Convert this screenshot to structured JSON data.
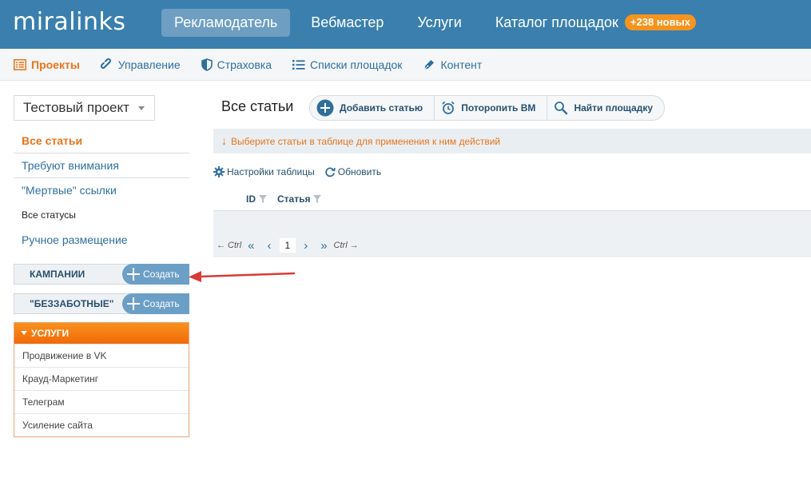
{
  "logo": "miralinks",
  "top_nav": {
    "items": [
      {
        "label": "Рекламодатель",
        "active": true
      },
      {
        "label": "Вебмастер",
        "active": false
      },
      {
        "label": "Услуги",
        "active": false
      },
      {
        "label": "Каталог площадок",
        "active": false
      }
    ],
    "catalog_badge": "+238 новых"
  },
  "sub_nav": {
    "items": [
      {
        "label": "Проекты",
        "icon": "list-icon",
        "active": true
      },
      {
        "label": "Управление",
        "icon": "link-icon",
        "active": false
      },
      {
        "label": "Страховка",
        "icon": "shield-icon",
        "active": false
      },
      {
        "label": "Списки площадок",
        "icon": "bullet-list-icon",
        "active": false
      },
      {
        "label": "Контент",
        "icon": "pen-icon",
        "active": false
      }
    ]
  },
  "sidebar": {
    "project": "Тестовый проект",
    "menu": [
      "Все статьи",
      "Требуют внимания",
      "\"Мертвые\" ссылки",
      "Все статусы",
      "Ручное размещение"
    ],
    "campaigns_label": "КАМПАНИИ",
    "carefree_label": "\"БЕЗЗАБОТНЫЕ\"",
    "create_label": "Создать",
    "services_label": "УСЛУГИ",
    "services": [
      "Продвижение в VK",
      "Крауд-Маркетинг",
      "Телеграм",
      "Усиление сайта"
    ]
  },
  "main": {
    "title": "Все статьи",
    "actions": {
      "add": "Добавить статью",
      "hurry": "Поторопить ВМ",
      "find": "Найти площадку"
    },
    "notice": "Выберите статьи в таблице для применения к ним действий",
    "tools": {
      "settings": "Настройки таблицы",
      "refresh": "Обновить"
    },
    "columns": [
      "ID",
      "Статья"
    ],
    "pager": {
      "prev_hint": "← Ctrl",
      "first": "«",
      "prev": "‹",
      "current": "1",
      "next": "›",
      "last": "»",
      "next_hint": "Ctrl →"
    }
  },
  "colors": {
    "topbar": "#3a7fae",
    "accent_orange": "#e8751a",
    "link_blue": "#2f6f9e",
    "annotation_red": "#d93b35"
  }
}
